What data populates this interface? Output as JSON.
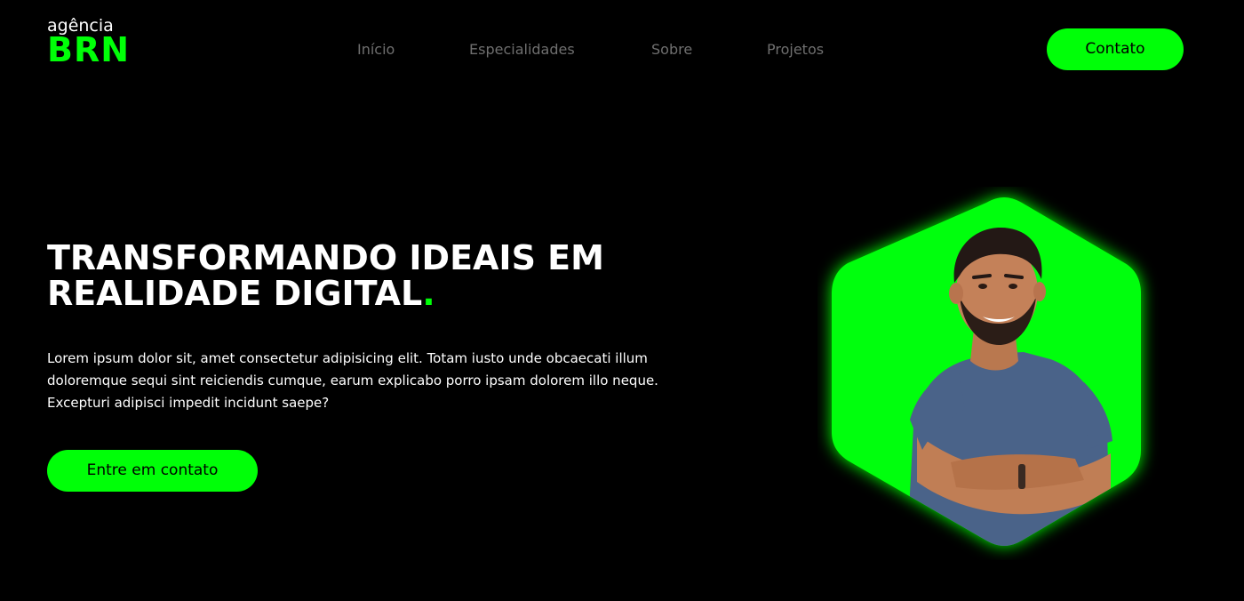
{
  "header": {
    "logo": {
      "top": "agência",
      "bottom": "BRN"
    },
    "nav": [
      {
        "label": "Início"
      },
      {
        "label": "Especialidades"
      },
      {
        "label": "Sobre"
      },
      {
        "label": "Projetos"
      }
    ],
    "cta_label": "Contato"
  },
  "hero": {
    "title_lines": [
      "TRANSFORMANDO IDEAIS EM",
      "REALIDADE DIGITAL"
    ],
    "title_dot": ".",
    "text_lines": [
      "Lorem ipsum dolor sit, amet consectetur adipisicing elit. Totam iusto unde obcaecati illum",
      "doloremque sequi sint reiciendis cumque, earum explicabo porro ipsam dolorem illo neque.",
      "Excepturi adipisci impedit incidunt saepe?"
    ],
    "cta_label": "Entre em contato"
  },
  "photo": {
    "icon": "person-portrait",
    "frame_shape": "hexagon"
  },
  "colors": {
    "accent": "#00ff08",
    "background": "#000000",
    "nav_text": "#6f6f6f",
    "text": "#ffffff"
  }
}
